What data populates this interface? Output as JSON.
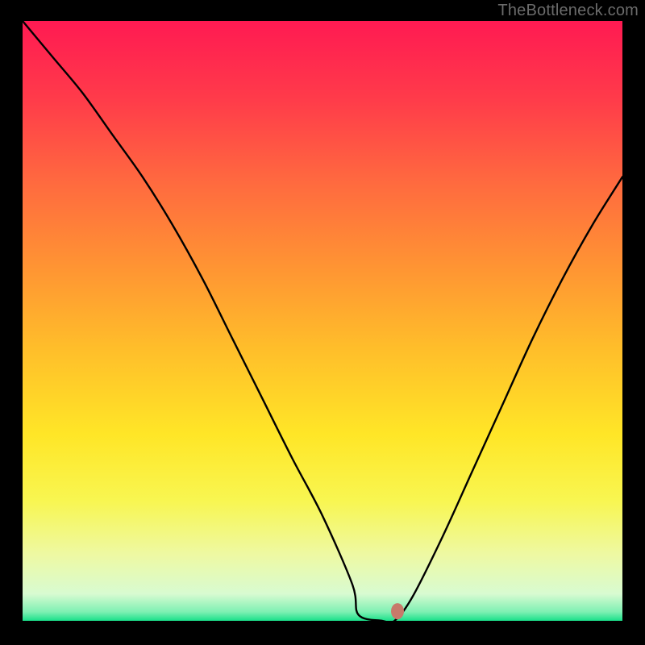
{
  "watermark": "TheBottleneck.com",
  "chart_data": {
    "type": "line",
    "title": "",
    "xlabel": "",
    "ylabel": "",
    "xlim": [
      0,
      100
    ],
    "ylim": [
      0,
      100
    ],
    "series": [
      {
        "name": "bottleneck-curve",
        "x": [
          0,
          5,
          10,
          15,
          20,
          25,
          30,
          35,
          40,
          45,
          50,
          55,
          56,
          60,
          62,
          65,
          70,
          75,
          80,
          85,
          90,
          95,
          100
        ],
        "values": [
          100,
          94,
          88,
          81,
          74,
          66,
          57,
          47,
          37,
          27,
          17.5,
          6,
          1,
          0,
          0,
          4,
          14,
          25,
          36,
          47,
          57,
          66,
          74
        ]
      }
    ],
    "marker": {
      "x": 62.5,
      "y": 1.6,
      "color": "#c77a6a"
    },
    "gradient_stops": [
      {
        "offset": 0.0,
        "color": "#ff1a52"
      },
      {
        "offset": 0.13,
        "color": "#ff3b4a"
      },
      {
        "offset": 0.27,
        "color": "#ff6a3f"
      },
      {
        "offset": 0.41,
        "color": "#ff9433"
      },
      {
        "offset": 0.55,
        "color": "#ffbf2a"
      },
      {
        "offset": 0.69,
        "color": "#ffe627"
      },
      {
        "offset": 0.8,
        "color": "#f8f651"
      },
      {
        "offset": 0.89,
        "color": "#eef9a3"
      },
      {
        "offset": 0.955,
        "color": "#d8fbd1"
      },
      {
        "offset": 0.985,
        "color": "#7ff0b3"
      },
      {
        "offset": 1.0,
        "color": "#19e08a"
      }
    ]
  }
}
